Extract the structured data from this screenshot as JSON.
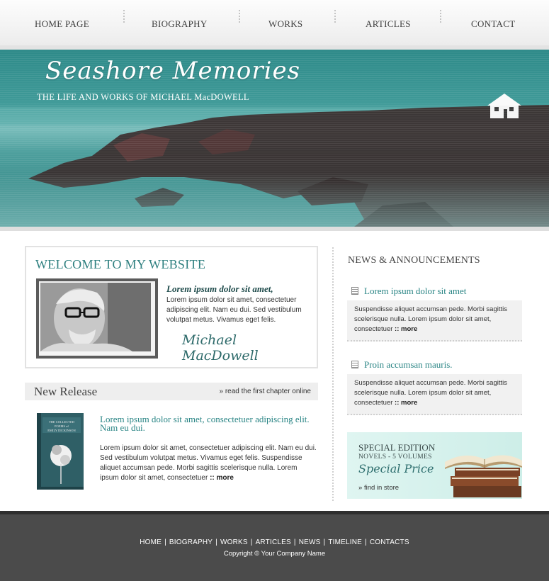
{
  "nav": {
    "items": [
      "HOME PAGE",
      "BIOGRAPHY",
      "WORKS",
      "ARTICLES",
      "CONTACT"
    ]
  },
  "banner": {
    "title": "Seashore Memories",
    "subtitle": "THE LIFE AND WORKS OF MICHAEL MacDOWELL"
  },
  "welcome": {
    "title": "WELCOME TO MY WEBSITE",
    "lead": "Lorem ipsum dolor sit amet,",
    "text": "Lorem ipsum dolor sit amet, consectetuer adipiscing elit. Nam eu dui. Sed vestibulum volutpat metus. Vivamus eget felis.",
    "signature": "Michael MacDowell"
  },
  "release": {
    "title": "New Release",
    "link": "read the first chapter online",
    "heading": "Lorem ipsum dolor sit amet, consectetuer adipiscing elit. Nam eu dui.",
    "text": "Lorem ipsum dolor sit amet, consectetuer adipiscing elit. Nam eu dui. Sed vestibulum volutpat metus. Vivamus eget felis. Suspendisse aliquet accumsan pede. Morbi sagittis scelerisque nulla. Lorem ipsum dolor sit amet, consectetuer",
    "more": ":: more",
    "book_cover": "THE COLLECTED POEMS of EMILY DICKINSON"
  },
  "news": {
    "title": "NEWS & ANNOUNCEMENTS",
    "items": [
      {
        "heading": "Lorem ipsum dolor sit amet",
        "text": "Suspendisse aliquet accumsan pede. Morbi sagittis scelerisque nulla. Lorem ipsum dolor sit amet, consectetuer",
        "more": ":: more"
      },
      {
        "heading": "Proin accumsan mauris.",
        "text": "Suspendisse aliquet accumsan pede. Morbi sagittis scelerisque nulla. Lorem ipsum dolor sit amet, consectetuer",
        "more": ":: more"
      }
    ]
  },
  "special": {
    "title": "SPECIAL EDITION",
    "sub": "NOVELS - 5 VOLUMES",
    "price": "Special Price",
    "link": "find in store"
  },
  "footer": {
    "links": [
      "HOME",
      "BIOGRAPHY",
      "WORKS",
      "ARTICLES",
      "NEWS",
      "TIMELINE",
      "CONTACTS"
    ],
    "separator": "|",
    "copyright": "Copyright © Your Company Name"
  },
  "colors": {
    "accent": "#2a8585",
    "banner": "#3f9a98",
    "footer": "#4b4b4b"
  }
}
